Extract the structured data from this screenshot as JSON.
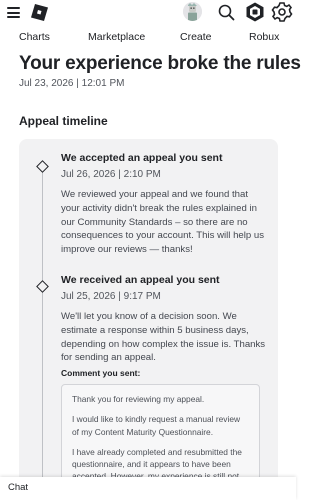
{
  "header": {
    "menu_icon": "hamburger-icon",
    "logo_icon": "roblox-logo-icon",
    "avatar_icon": "avatar-icon",
    "search_icon": "search-icon",
    "robux_icon": "robux-icon",
    "settings_icon": "gear-icon"
  },
  "nav": {
    "items": [
      "Charts",
      "Marketplace",
      "Create",
      "Robux"
    ]
  },
  "page": {
    "title": "Your experience broke the rules",
    "date": "Jul 23, 2026 | 12:01 PM",
    "section_heading": "Appeal timeline"
  },
  "timeline": [
    {
      "title": "We accepted an appeal you sent",
      "date": "Jul 26, 2026 | 2:10 PM",
      "body": "We reviewed your appeal and we found that your activity didn't break the rules explained in our Community Standards – so there are no consequences to your account. This will help us improve our reviews — thanks!"
    },
    {
      "title": "We received an appeal you sent",
      "date": "Jul 25, 2026 | 9:17 PM",
      "body": "We'll let you know of a decision soon. We estimate a response within 5 business days, depending on how complex the issue is. Thanks for sending an appeal."
    }
  ],
  "comment": {
    "label": "Comment you sent:",
    "paragraphs": [
      "Thank you for reviewing my appeal.",
      "I would like to kindly request a manual review of my Content Maturity Questionnaire.",
      "I have already completed and resubmitted the questionnaire, and it appears to have been accepted. However, my experience is still not"
    ]
  },
  "chat": {
    "label": "Chat"
  },
  "colors": {
    "card_bg": "#f2f2f3",
    "text": "#202226",
    "muted": "#51555c"
  }
}
